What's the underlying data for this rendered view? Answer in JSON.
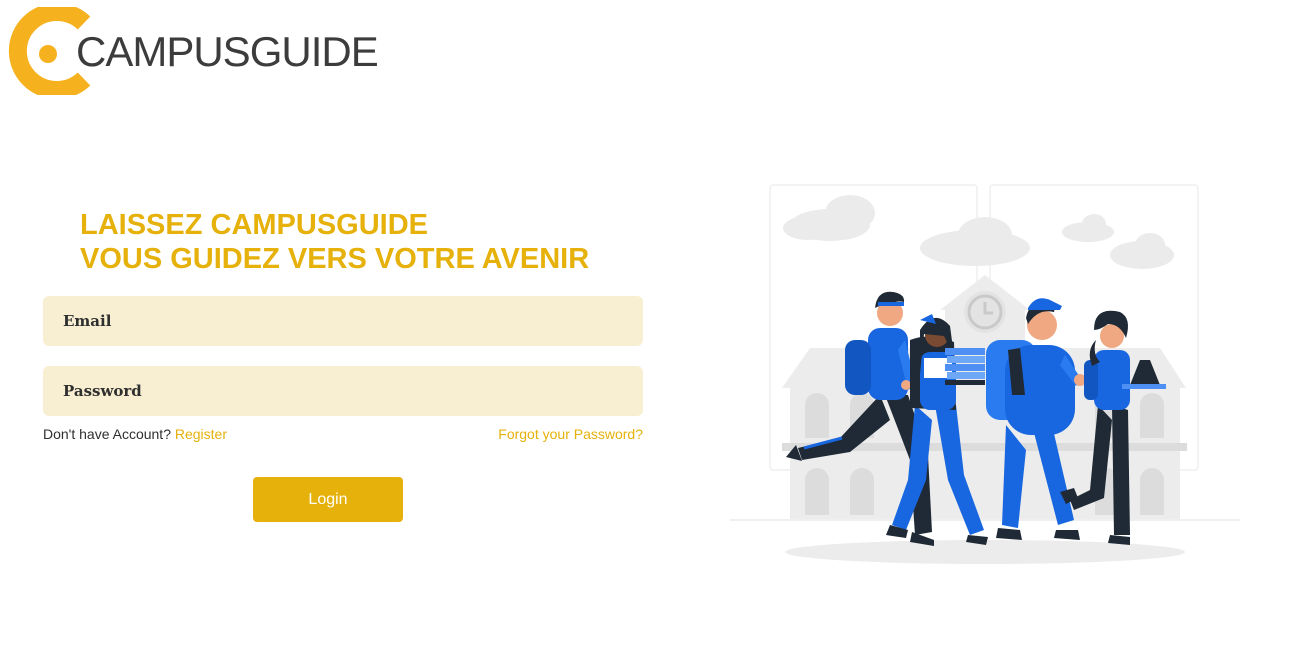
{
  "brand": {
    "name": "CAMPUSGUIDE",
    "accent_color": "#f6b11e",
    "text_color": "#3c3c3c"
  },
  "headline": {
    "line1": "LAISSEZ CAMPUSGUIDE",
    "line2": "VOUS GUIDEZ VERS VOTRE AVENIR",
    "color": "#e5b10a"
  },
  "form": {
    "email_placeholder": "Email",
    "password_placeholder": "Password",
    "no_account_text": "Don't have Account?",
    "register_label": "Register",
    "forgot_label": "Forgot your Password?",
    "login_label": "Login",
    "field_bg": "#f8efd2",
    "button_color": "#e5b10a"
  },
  "illustration": {
    "subject": "students-walking-to-campus",
    "primary_color": "#1967e0",
    "dark_color": "#1f2a36"
  }
}
